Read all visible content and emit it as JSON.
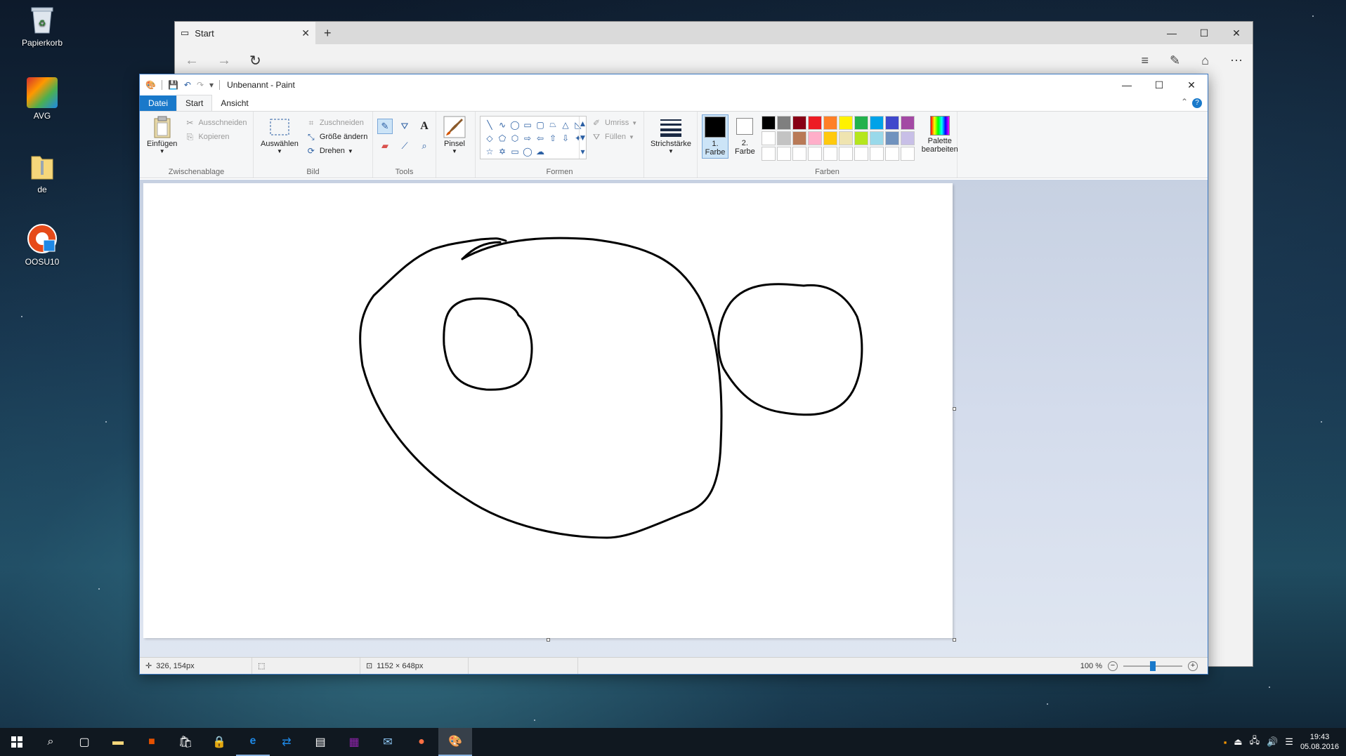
{
  "desktop": {
    "icons": [
      {
        "label": "Papierkorb"
      },
      {
        "label": "AVG"
      },
      {
        "label": "de"
      },
      {
        "label": "OOSU10"
      }
    ]
  },
  "browser": {
    "tab_title": "Start"
  },
  "paint": {
    "title": "Unbenannt - Paint",
    "tabs": {
      "file": "Datei",
      "home": "Start",
      "view": "Ansicht"
    },
    "help": "?",
    "clipboard": {
      "paste": "Einfügen",
      "cut": "Ausschneiden",
      "copy": "Kopieren",
      "label": "Zwischenablage"
    },
    "image": {
      "select": "Auswählen",
      "crop": "Zuschneiden",
      "resize": "Größe ändern",
      "rotate": "Drehen",
      "label": "Bild"
    },
    "tools": {
      "label": "Tools"
    },
    "brushes": {
      "label": "Pinsel"
    },
    "shapes": {
      "outline": "Umriss",
      "fill": "Füllen",
      "label": "Formen"
    },
    "size": {
      "label": "Strichstärke"
    },
    "colors": {
      "color1_number": "1.",
      "color1_label": "Farbe",
      "color2_number": "2.",
      "color2_label": "Farbe",
      "edit_palette": "Palette bearbeiten",
      "label": "Farben",
      "color1": "#000000",
      "color2": "#ffffff",
      "palette": [
        "#000000",
        "#7f7f7f",
        "#880015",
        "#ed1c24",
        "#ff7f27",
        "#fff200",
        "#22b14c",
        "#00a2e8",
        "#3f48cc",
        "#a349a4",
        "#ffffff",
        "#c3c3c3",
        "#b97a57",
        "#ffaec9",
        "#ffc90e",
        "#efe4b0",
        "#b5e61d",
        "#99d9ea",
        "#7092be",
        "#c8bfe7",
        "#ffffff",
        "#ffffff",
        "#ffffff",
        "#ffffff",
        "#ffffff",
        "#ffffff",
        "#ffffff",
        "#ffffff",
        "#ffffff",
        "#ffffff"
      ]
    },
    "status": {
      "cursor_pos": "326, 154px",
      "image_size": "1152 × 648px",
      "zoom": "100 %"
    }
  },
  "taskbar": {
    "time": "19:43",
    "date": "05.08.2016"
  }
}
